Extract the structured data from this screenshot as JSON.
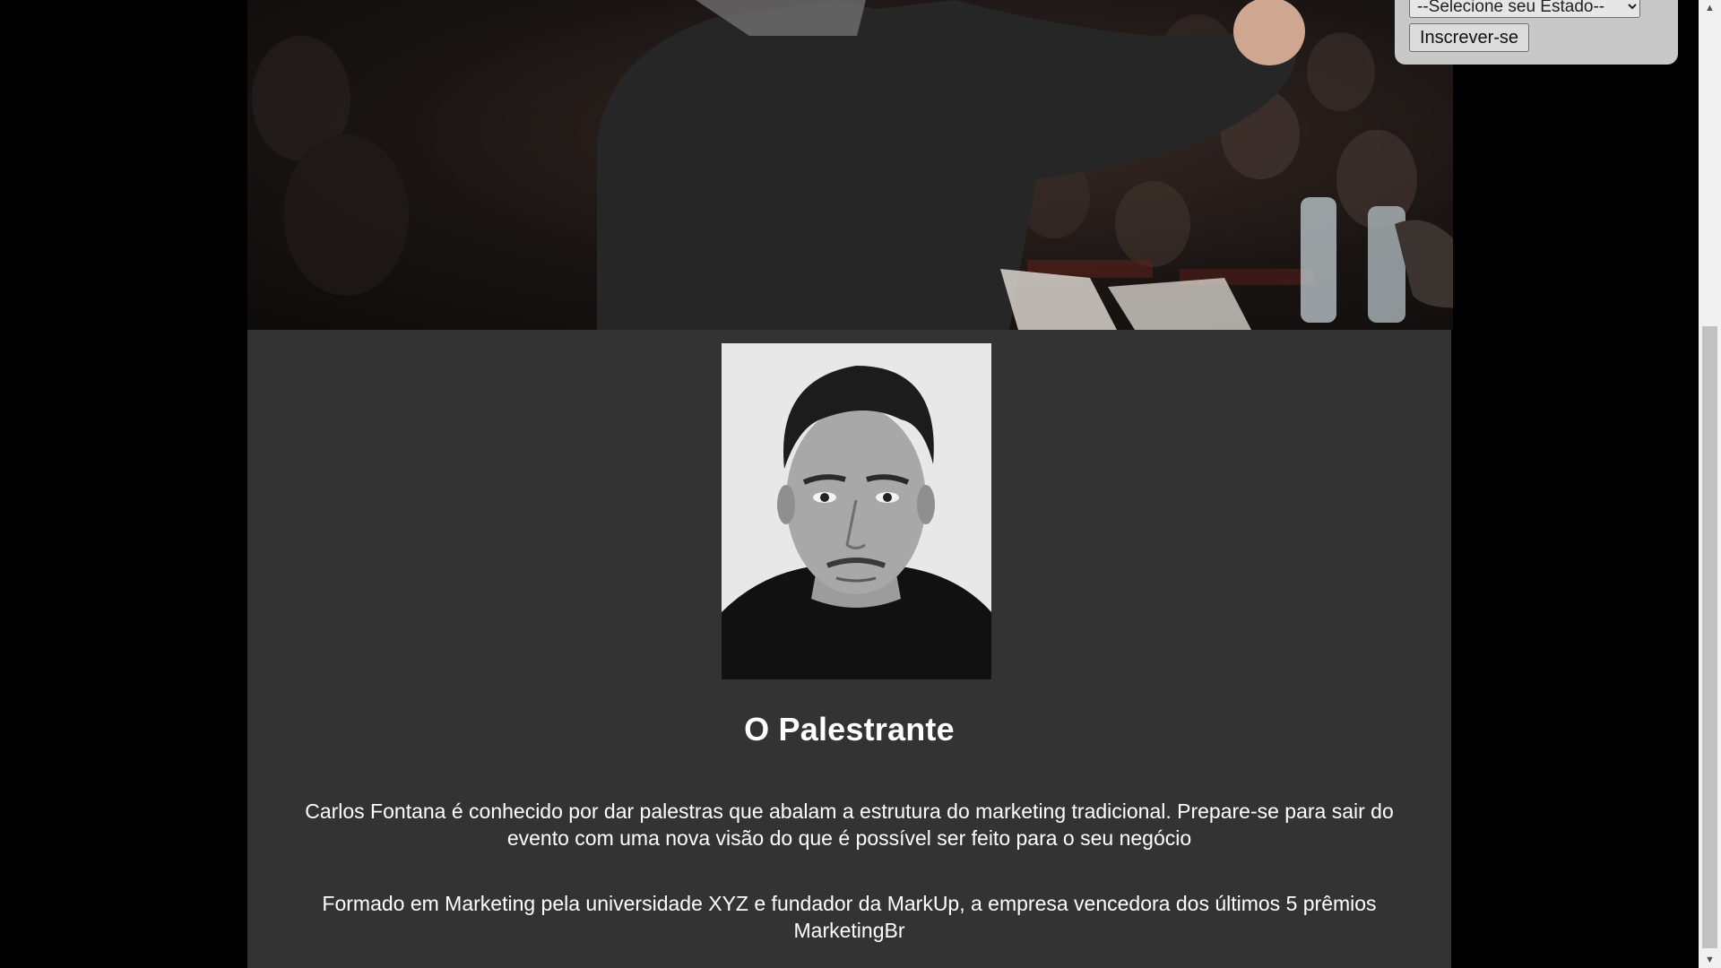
{
  "signup": {
    "state_select_value": "--Selecione seu Estado--",
    "subscribe_label": "Inscrever-se"
  },
  "speaker": {
    "title": "O Palestrante",
    "paragraph_1": "Carlos Fontana é conhecido por dar palestras que abalam a estrutura do marketing tradicional. Prepare-se para sair do evento com uma nova visão do que é possível ser feito para o seu negócio",
    "paragraph_2": "Formado em Marketing pela universidade XYZ e fundador da MarkUp, a empresa vencedora dos últimos 5 prêmios MarketingBr"
  },
  "colors": {
    "page_background": "#000000",
    "section_background": "#333333",
    "text": "#ffffff",
    "form_background": "#c8c8c8"
  },
  "icons": {
    "select_arrow": "chevron-down-icon",
    "scroll_up": "scroll-up-arrow-icon",
    "scroll_down": "scroll-down-arrow-icon"
  }
}
